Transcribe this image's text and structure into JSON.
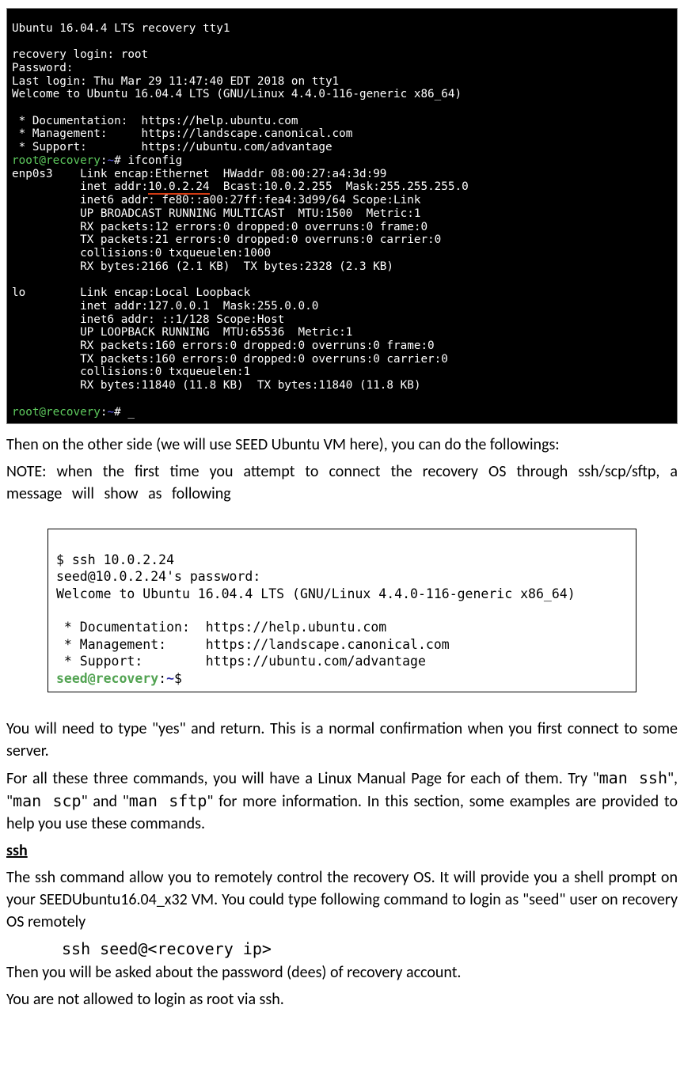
{
  "term1": {
    "l1": "Ubuntu 16.04.4 LTS recovery tty1",
    "l2": "",
    "l3": "recovery login: root",
    "l4": "Password:",
    "l5": "Last login: Thu Mar 29 11:47:40 EDT 2018 on tty1",
    "l6": "Welcome to Ubuntu 16.04.4 LTS (GNU/Linux 4.4.0-116-generic x86_64)",
    "l7": "",
    "l8": " * Documentation:  https://help.ubuntu.com",
    "l9": " * Management:     https://landscape.canonical.com",
    "l10": " * Support:        https://ubuntu.com/advantage",
    "prompt1_user": "root@recovery",
    "prompt1_path": "~",
    "prompt1_cmd": "# ifconfig",
    "if1_name": "enp0s3    ",
    "if1_l1": "Link encap:Ethernet  HWaddr 08:00:27:a4:3d:99",
    "if1_l2a": "          inet addr:",
    "if1_l2b": "10.0.2.24",
    "if1_l2c": "  Bcast:10.0.2.255  Mask:255.255.255.0",
    "if1_l3": "          inet6 addr: fe80::a00:27ff:fea4:3d99/64 Scope:Link",
    "if1_l4": "          UP BROADCAST RUNNING MULTICAST  MTU:1500  Metric:1",
    "if1_l5": "          RX packets:12 errors:0 dropped:0 overruns:0 frame:0",
    "if1_l6": "          TX packets:21 errors:0 dropped:0 overruns:0 carrier:0",
    "if1_l7": "          collisions:0 txqueuelen:1000",
    "if1_l8": "          RX bytes:2166 (2.1 KB)  TX bytes:2328 (2.3 KB)",
    "blank1": "",
    "if2_name": "lo        ",
    "if2_l1": "Link encap:Local Loopback",
    "if2_l2": "          inet addr:127.0.0.1  Mask:255.0.0.0",
    "if2_l3": "          inet6 addr: ::1/128 Scope:Host",
    "if2_l4": "          UP LOOPBACK RUNNING  MTU:65536  Metric:1",
    "if2_l5": "          RX packets:160 errors:0 dropped:0 overruns:0 frame:0",
    "if2_l6": "          TX packets:160 errors:0 dropped:0 overruns:0 carrier:0",
    "if2_l7": "          collisions:0 txqueuelen:1",
    "if2_l8": "          RX bytes:11840 (11.8 KB)  TX bytes:11840 (11.8 KB)",
    "blank2": "",
    "prompt2_user": "root@recovery",
    "prompt2_path": "~",
    "prompt2_cmd": "# _"
  },
  "para1": "Then on the other side (we will use SEED Ubuntu VM here), you can do the followings:",
  "para1b": "NOTE: when the first time you attempt to connect the recovery OS through ssh/scp/sftp, a message will show as following",
  "term2": {
    "l1": "$ ssh 10.0.2.24",
    "l2": "seed@10.0.2.24's password:",
    "l3": "Welcome to Ubuntu 16.04.4 LTS (GNU/Linux 4.4.0-116-generic x86_64)",
    "l4": "",
    "l5": " * Documentation:  https://help.ubuntu.com",
    "l6": " * Management:     https://landscape.canonical.com",
    "l7": " * Support:        https://ubuntu.com/advantage",
    "prompt_user": "seed@recovery",
    "prompt_colon": ":",
    "prompt_path": "~",
    "prompt_end": "$"
  },
  "para2a": "You will need to type \"yes\" and return. This is a normal confirmation when you first connect to some server.",
  "para2b_1": "For all these three commands, you will have a Linux Manual Page for each of them. Try \"",
  "cmd1": "man ssh",
  "para2b_2": "\", \"",
  "cmd2": "man scp",
  "para2b_3": "\" and \"",
  "cmd3": "man sftp",
  "para2b_4": "\" for more information. In this section, some examples are provided to help you use these commands.",
  "ssh_heading": "ssh",
  "para3a": "The ssh command allow you to remotely control the recovery OS. It will provide you a shell prompt on your SEEDUbuntu16.04_x32 VM. You could type following command to login as \"seed\" user on recovery OS remotely",
  "ssh_cmd": "ssh seed@<recovery ip>",
  "para3b": "Then you will be asked about the password (dees) of recovery account.",
  "para3c": "You are not allowed to login as root via ssh."
}
